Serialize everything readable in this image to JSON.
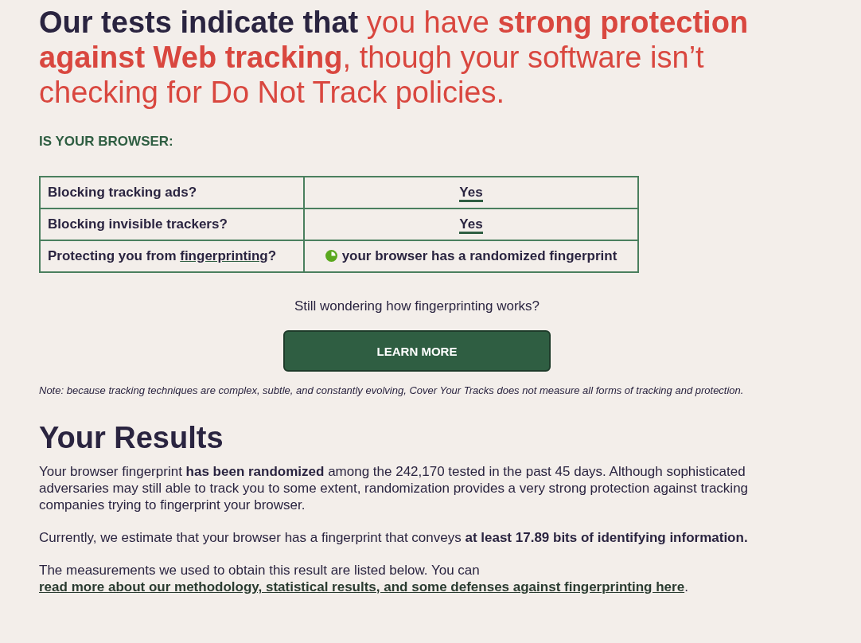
{
  "headline": {
    "lead": "Our tests indicate that",
    "verdict": "you have **strong protection against Web tracking**, though your software isn’t checking for Do Not Track policies."
  },
  "table_heading": "IS YOUR BROWSER:",
  "checks": [
    {
      "kind": "link",
      "label": "Blocking tracking ads?",
      "value": "Yes"
    },
    {
      "kind": "link",
      "label": "Blocking invisible trackers?",
      "value": "Yes"
    },
    {
      "kind": "status",
      "label": "Protecting you from ",
      "label_link": "fingerprinting",
      "label_end": "?",
      "value": "your browser has a randomized fingerprint"
    }
  ],
  "prompt": "Still wondering how fingerprinting works?",
  "learn_more_button": "LEARN MORE",
  "note": "Note: because tracking techniques are complex, subtle, and constantly evolving, Cover Your Tracks does not measure all forms of tracking and protection.",
  "results": {
    "title": "Your Results",
    "paragraphs": [
      {
        "text": "Your browser fingerprint **has been randomized** among the 242,170 tested in the past 45 days. Although sophisticated adversaries may still able to track you to some extent, randomization provides a very strong protection against tracking companies trying to fingerprint your browser."
      },
      {
        "text": "Currently, we estimate that your browser has a fingerprint that conveys **at least 17.89 bits of identifying information.**"
      },
      {
        "text": "The measurements we used to obtain this result are listed below. You can ",
        "link": "read more about our methodology, statistical results, and some defenses against fingerprinting here",
        "end": "."
      }
    ]
  }
}
